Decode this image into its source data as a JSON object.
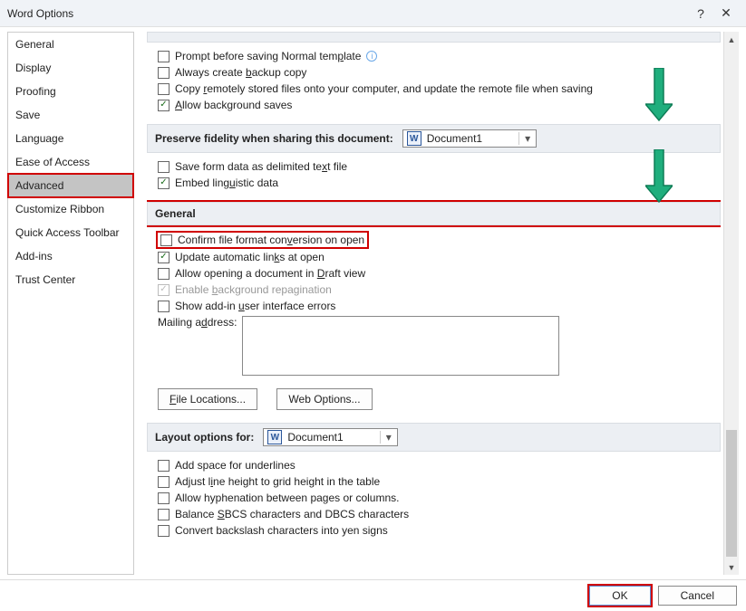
{
  "title": "Word Options",
  "sidebar": {
    "items": [
      {
        "label": "General"
      },
      {
        "label": "Display"
      },
      {
        "label": "Proofing"
      },
      {
        "label": "Save"
      },
      {
        "label": "Language"
      },
      {
        "label": "Ease of Access"
      },
      {
        "label": "Advanced"
      },
      {
        "label": "Customize Ribbon"
      },
      {
        "label": "Quick Access Toolbar"
      },
      {
        "label": "Add-ins"
      },
      {
        "label": "Trust Center"
      }
    ]
  },
  "save_section": {
    "items": [
      {
        "label_html": "Prompt before saving Normal tem<u class='key'>p</u>late",
        "checked": false,
        "info": true
      },
      {
        "label_html": "Always create <u class='key'>b</u>ackup copy",
        "checked": false
      },
      {
        "label_html": "Copy <u class='key'>r</u>emotely stored files onto your computer, and update the remote file when saving",
        "checked": false
      },
      {
        "label_html": "<u class='key'>A</u>llow background saves",
        "checked": true
      }
    ]
  },
  "preserve_header": "Preserve fidelity when sharing this document:",
  "preserve_doc": "Document1",
  "preserve_items": [
    {
      "label_html": "Save form data as delimited te<u class='key'>x</u>t file",
      "checked": false
    },
    {
      "label_html": "Embed ling<u class='key'>u</u>istic data",
      "checked": true
    }
  ],
  "general_header": "General",
  "general_items": [
    {
      "label_html": "Confirm file format con<u class='key'>v</u>ersion on open",
      "checked": false,
      "highlight": true
    },
    {
      "label_html": "Update automatic lin<u class='key'>k</u>s at open",
      "checked": true
    },
    {
      "label_html": "Allow opening a document in <u class='key'>D</u>raft view",
      "checked": false
    },
    {
      "label_html": "Enable <u class='key'>b</u>ackground repagination",
      "checked": true,
      "disabled": true
    },
    {
      "label_html": "Show add-in <u class='key'>u</u>ser interface errors",
      "checked": false
    }
  ],
  "mailing_label_html": "Mailing a<u class='key'>d</u>dress:",
  "btn_file_locations_html": "<u class='key'>F</u>ile Locations...",
  "btn_web_options": "Web Options...",
  "layout_header": "Layout options for:",
  "layout_doc": "Document1",
  "layout_items": [
    {
      "label_html": "Add space for underlines",
      "checked": false
    },
    {
      "label_html": "Adjust l<u class='key'>i</u>ne height to grid height in the table",
      "checked": false
    },
    {
      "label_html": "Allow hyphenation between pages or columns.",
      "checked": false
    },
    {
      "label_html": "Balance <u class='key'>S</u>BCS characters and DBCS characters",
      "checked": false
    },
    {
      "label_html": "Convert backslash characters into yen signs",
      "checked": false
    }
  ],
  "footer": {
    "ok": "OK",
    "cancel": "Cancel"
  }
}
